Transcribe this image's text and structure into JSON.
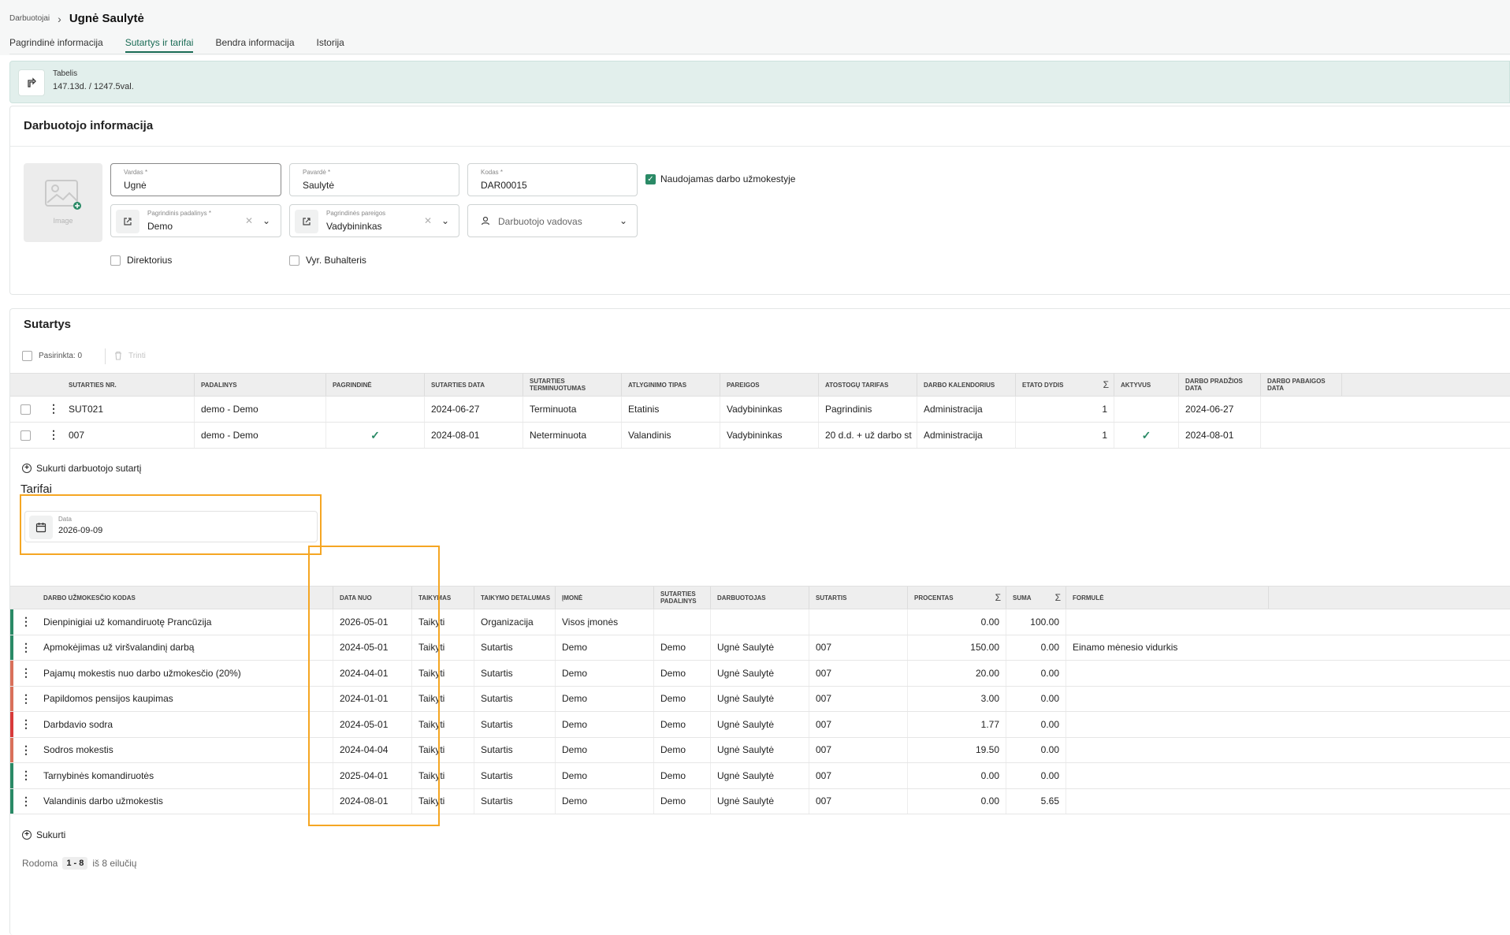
{
  "breadcrumb": {
    "parent": "Darbuotojai",
    "title": "Ugnė Saulytė"
  },
  "tabs": [
    {
      "label": "Pagrindinė informacija"
    },
    {
      "label": "Sutartys ir tarifai"
    },
    {
      "label": "Bendra informacija"
    },
    {
      "label": "Istorija"
    }
  ],
  "active_tab": "Sutartys ir tarifai",
  "tabelis": {
    "label": "Tabelis",
    "value": "147.13d. / 1247.5val."
  },
  "employee": {
    "title": "Darbuotojo informacija",
    "image_label": "Image",
    "first_name": {
      "label": "Vardas *",
      "value": "Ugnė"
    },
    "last_name": {
      "label": "Pavardė *",
      "value": "Saulytė"
    },
    "code": {
      "label": "Kodas *",
      "value": "DAR00015"
    },
    "used_in_payroll": {
      "label": "Naudojamas darbo užmokestyje",
      "checked": true
    },
    "department": {
      "label": "Pagrindinis padalinys *",
      "value": "Demo"
    },
    "position": {
      "label": "Pagrindinės pareigos",
      "value": "Vadybininkas"
    },
    "manager": {
      "placeholder": "Darbuotojo vadovas"
    },
    "director": {
      "label": "Direktorius",
      "checked": false
    },
    "chief_accountant": {
      "label": "Vyr. Buhalteris",
      "checked": false
    }
  },
  "contracts": {
    "title": "Sutartys",
    "selected_label": "Pasirinkta: 0",
    "delete_label": "Trinti",
    "sum_symbol": "Σ",
    "columns": [
      "Sutarties nr.",
      "Padalinys",
      "Pagrindinė",
      "Sutarties data",
      "Sutarties terminuotumas",
      "Atlyginimo tipas",
      "Pareigos",
      "Atostogų tarifas",
      "Darbo kalendorius",
      "Etato dydis",
      "Aktyvus",
      "Darbo pradžios data",
      "Darbo pabaigos data"
    ],
    "rows": [
      {
        "nr": "SUT021",
        "dept": "demo - Demo",
        "main": false,
        "date": "2024-06-27",
        "term": "Terminuota",
        "pay": "Etatinis",
        "position": "Vadybininkas",
        "vac": "Pagrindinis",
        "cal": "Administracija",
        "fte": "1",
        "active": false,
        "start": "2024-06-27",
        "end": ""
      },
      {
        "nr": "007",
        "dept": "demo - Demo",
        "main": true,
        "date": "2024-08-01",
        "term": "Neterminuota",
        "pay": "Valandinis",
        "position": "Vadybininkas",
        "vac": "20 d.d. + už darbo st",
        "cal": "Administracija",
        "fte": "1",
        "active": true,
        "start": "2024-08-01",
        "end": ""
      }
    ],
    "create_label": "Sukurti darbuotojo sutartį"
  },
  "tariffs": {
    "title": "Tarifai",
    "date_label": "Data",
    "date_value": "2026-09-09",
    "sum_symbol": "Σ",
    "columns": [
      "Darbo užmokesčio kodas",
      "Data nuo",
      "Taikymas",
      "Taikymo detalumas",
      "Įmonė",
      "Sutarties padalinys",
      "Darbuotojas",
      "Sutartis",
      "Procentas",
      "Suma",
      "Formulė"
    ],
    "rows": [
      {
        "code": "Dienpinigiai už komandiruotę Prancūzija",
        "date": "2026-05-01",
        "apply": "Taikyti",
        "detail": "Organizacija",
        "company": "Visos įmonės",
        "dept": "",
        "employee": "",
        "contract": "",
        "pct": "0.00",
        "sum": "100.00",
        "formula": "",
        "color": "#2a8a66"
      },
      {
        "code": "Apmokėjimas už viršvalandinį darbą",
        "date": "2024-05-01",
        "apply": "Taikyti",
        "detail": "Sutartis",
        "company": "Demo",
        "dept": "Demo",
        "employee": "Ugnė Saulytė",
        "contract": "007",
        "pct": "150.00",
        "sum": "0.00",
        "formula": "Einamo mėnesio vidurkis",
        "color": "#2a8a66"
      },
      {
        "code": "Pajamų mokestis nuo darbo užmokesčio (20%)",
        "date": "2024-04-01",
        "apply": "Taikyti",
        "detail": "Sutartis",
        "company": "Demo",
        "dept": "Demo",
        "employee": "Ugnė Saulytė",
        "contract": "007",
        "pct": "20.00",
        "sum": "0.00",
        "formula": "",
        "color": "#d9705a"
      },
      {
        "code": "Papildomos pensijos kaupimas",
        "date": "2024-01-01",
        "apply": "Taikyti",
        "detail": "Sutartis",
        "company": "Demo",
        "dept": "Demo",
        "employee": "Ugnė Saulytė",
        "contract": "007",
        "pct": "3.00",
        "sum": "0.00",
        "formula": "",
        "color": "#d9705a"
      },
      {
        "code": "Darbdavio sodra",
        "date": "2024-05-01",
        "apply": "Taikyti",
        "detail": "Sutartis",
        "company": "Demo",
        "dept": "Demo",
        "employee": "Ugnė Saulytė",
        "contract": "007",
        "pct": "1.77",
        "sum": "0.00",
        "formula": "",
        "color": "#d83a3a"
      },
      {
        "code": "Sodros mokestis",
        "date": "2024-04-04",
        "apply": "Taikyti",
        "detail": "Sutartis",
        "company": "Demo",
        "dept": "Demo",
        "employee": "Ugnė Saulytė",
        "contract": "007",
        "pct": "19.50",
        "sum": "0.00",
        "formula": "",
        "color": "#d9705a"
      },
      {
        "code": "Tarnybinės komandiruotės",
        "date": "2025-04-01",
        "apply": "Taikyti",
        "detail": "Sutartis",
        "company": "Demo",
        "dept": "Demo",
        "employee": "Ugnė Saulytė",
        "contract": "007",
        "pct": "0.00",
        "sum": "0.00",
        "formula": "",
        "color": "#2a8a66"
      },
      {
        "code": "Valandinis darbo užmokestis",
        "date": "2024-08-01",
        "apply": "Taikyti",
        "detail": "Sutartis",
        "company": "Demo",
        "dept": "Demo",
        "employee": "Ugnė Saulytė",
        "contract": "007",
        "pct": "0.00",
        "sum": "5.65",
        "formula": "",
        "color": "#2a8a66"
      }
    ],
    "create_label": "Sukurti",
    "pagination": {
      "prefix": "Rodoma",
      "range": "1 - 8",
      "suffix": "iš 8 eilučių"
    }
  }
}
